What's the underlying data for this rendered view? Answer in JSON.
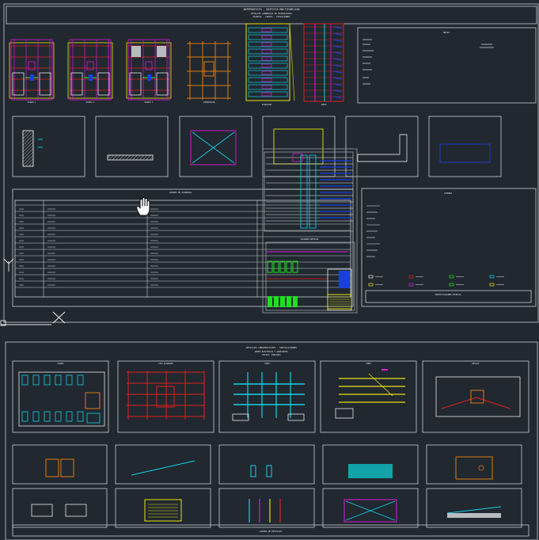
{
  "app": {
    "view": "Model space",
    "cursor_tool": "pan"
  },
  "colors": {
    "background": "#212830",
    "frame": "#c9ced4",
    "white": "#e6e9ec",
    "cyan": "#15d0e6",
    "magenta": "#d81bd8",
    "red": "#e0201c",
    "yellow": "#e8e215",
    "green": "#1ee01e",
    "blue": "#1a3fe0",
    "orange": "#e07a10",
    "teal": "#12a3a8"
  },
  "sheet1": {
    "title_lines": [
      "ANTEPROYECTO - EDIFICIO MULTIFAMILIAR",
      "DETALLES GENERALES DE ESTRUCTURAS",
      "PLANTAS - CORTES - ELEVACIONES"
    ],
    "plan_labels": [
      "PLANTA 1",
      "PLANTA 2",
      "PLANTA 3",
      "CIMENTACION",
      "ELEVACION",
      "CORTE"
    ],
    "notes_title": "NOTAS",
    "table_title": "CUADRO DE ACABADOS",
    "legend_title": "LEYENDA",
    "legend_foot": "ESPECIFICACIONES TECNICAS",
    "riser_title": "DIAGRAMA UNIFILAR"
  },
  "sheet2": {
    "title_lines": [
      "DETALLES CONSTRUCTIVOS - INSTALACIONES",
      "REDES ELECTRICAS Y SANITARIAS",
      "ESCALA: INDICADA"
    ],
    "panel_titles": [
      "PLANTA",
      "LOSA ALIGERADA",
      "VIGAS",
      "CORTE",
      "DETALLE"
    ],
    "title_block": "LAMINA DE DETALLES"
  },
  "icons": [
    "pan-hand-icon",
    "ucs-icon",
    "crosshair-icon"
  ]
}
